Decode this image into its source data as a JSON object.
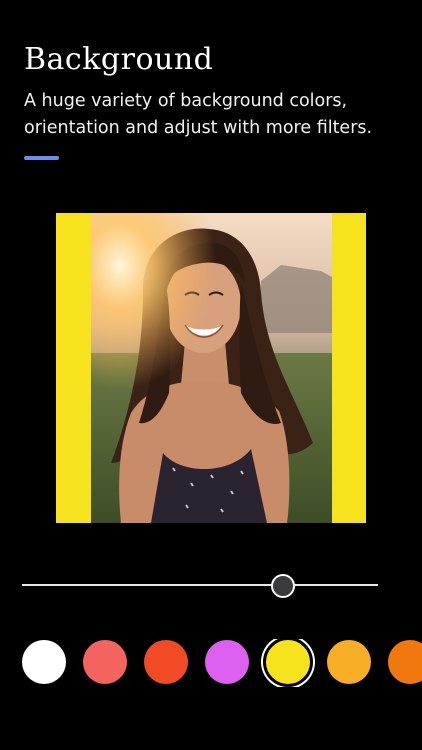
{
  "header": {
    "title": "Background",
    "description": "A huge variety of background colors, orientation and adjust with more filters.",
    "accent_color": "#6f8ff0"
  },
  "preview": {
    "background_color": "#f7e21e",
    "image_description": "photo-smiling-woman-outdoors"
  },
  "slider": {
    "value": 0.73
  },
  "color_swatches": [
    {
      "color": "#ffffff",
      "selected": false
    },
    {
      "color": "#f4645f",
      "selected": false
    },
    {
      "color": "#f04b24",
      "selected": false
    },
    {
      "color": "#dd61f0",
      "selected": false
    },
    {
      "color": "#f7e21e",
      "selected": true
    },
    {
      "color": "#f6ae26",
      "selected": false
    },
    {
      "color": "#f0780f",
      "selected": false
    }
  ]
}
